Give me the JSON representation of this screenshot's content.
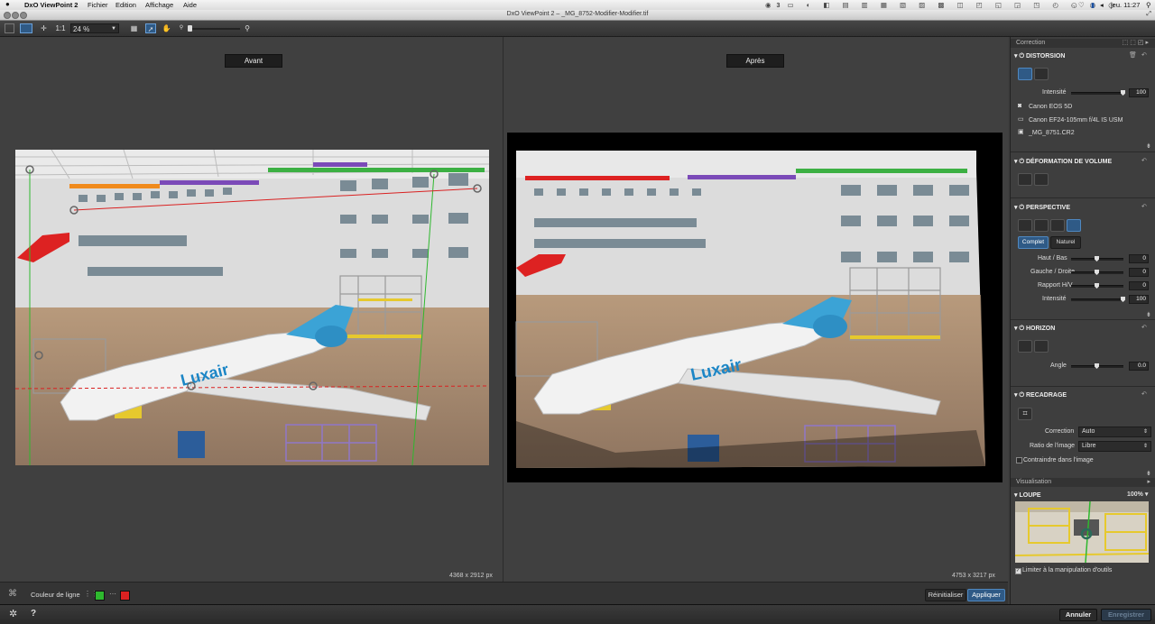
{
  "menubar": {
    "app": "DxO ViewPoint 2",
    "menus": [
      "Fichier",
      "Edition",
      "Affichage",
      "Aide"
    ],
    "clock": "jeu. 11:27",
    "badge": "3"
  },
  "window": {
    "title": "DxO ViewPoint 2 – _MG_8752-Modifier-Modifier.tif"
  },
  "toolbar": {
    "ratio": "1:1",
    "zoom": "24 %"
  },
  "views": {
    "before_label": "Avant",
    "after_label": "Après",
    "before_dims": "4368 x 2912 px",
    "after_dims": "4753 x 3217 px"
  },
  "statusbar": {
    "line_color_label": "Couleur de ligne",
    "reset": "Réinitialiser",
    "apply": "Appliquer"
  },
  "footer": {
    "cancel": "Annuler",
    "save": "Enregistrer",
    "help": "?"
  },
  "panel": {
    "correction_header": "Correction",
    "distortion": {
      "title": "DISTORSION",
      "intensity_label": "Intensité",
      "intensity_value": "100",
      "intensity_level": 1.0,
      "camera": "Canon EOS 5D",
      "lens": "Canon EF24-105mm f/4L IS USM",
      "file": "_MG_8751.CR2"
    },
    "volume": {
      "title": "DÉFORMATION DE VOLUME"
    },
    "perspective": {
      "title": "PERSPECTIVE",
      "mode_complete": "Complet",
      "mode_natural": "Naturel",
      "sliders": [
        {
          "label": "Haut / Bas",
          "value": "0",
          "level": 0.5
        },
        {
          "label": "Gauche / Droite",
          "value": "0",
          "level": 0.5
        },
        {
          "label": "Rapport H/V",
          "value": "0",
          "level": 0.5
        },
        {
          "label": "Intensité",
          "value": "100",
          "level": 1.0
        }
      ]
    },
    "horizon": {
      "title": "HORIZON",
      "angle_label": "Angle",
      "angle_value": "0.0",
      "angle_level": 0.5
    },
    "crop": {
      "title": "RECADRAGE",
      "correction_label": "Correction",
      "correction_value": "Auto",
      "ratio_label": "Ratio de l'image",
      "ratio_value": "Libre",
      "constrain_label": "Contraindre dans l'image"
    },
    "visualisation_header": "Visualisation",
    "loupe": {
      "title": "LOUPE",
      "zoom": "100%",
      "limit_label": "Limiter à la manipulation d'outils"
    }
  },
  "colors": {
    "line_green": "#2eb82e",
    "line_red": "#d92121",
    "accent_blue": "#2f5a86"
  }
}
